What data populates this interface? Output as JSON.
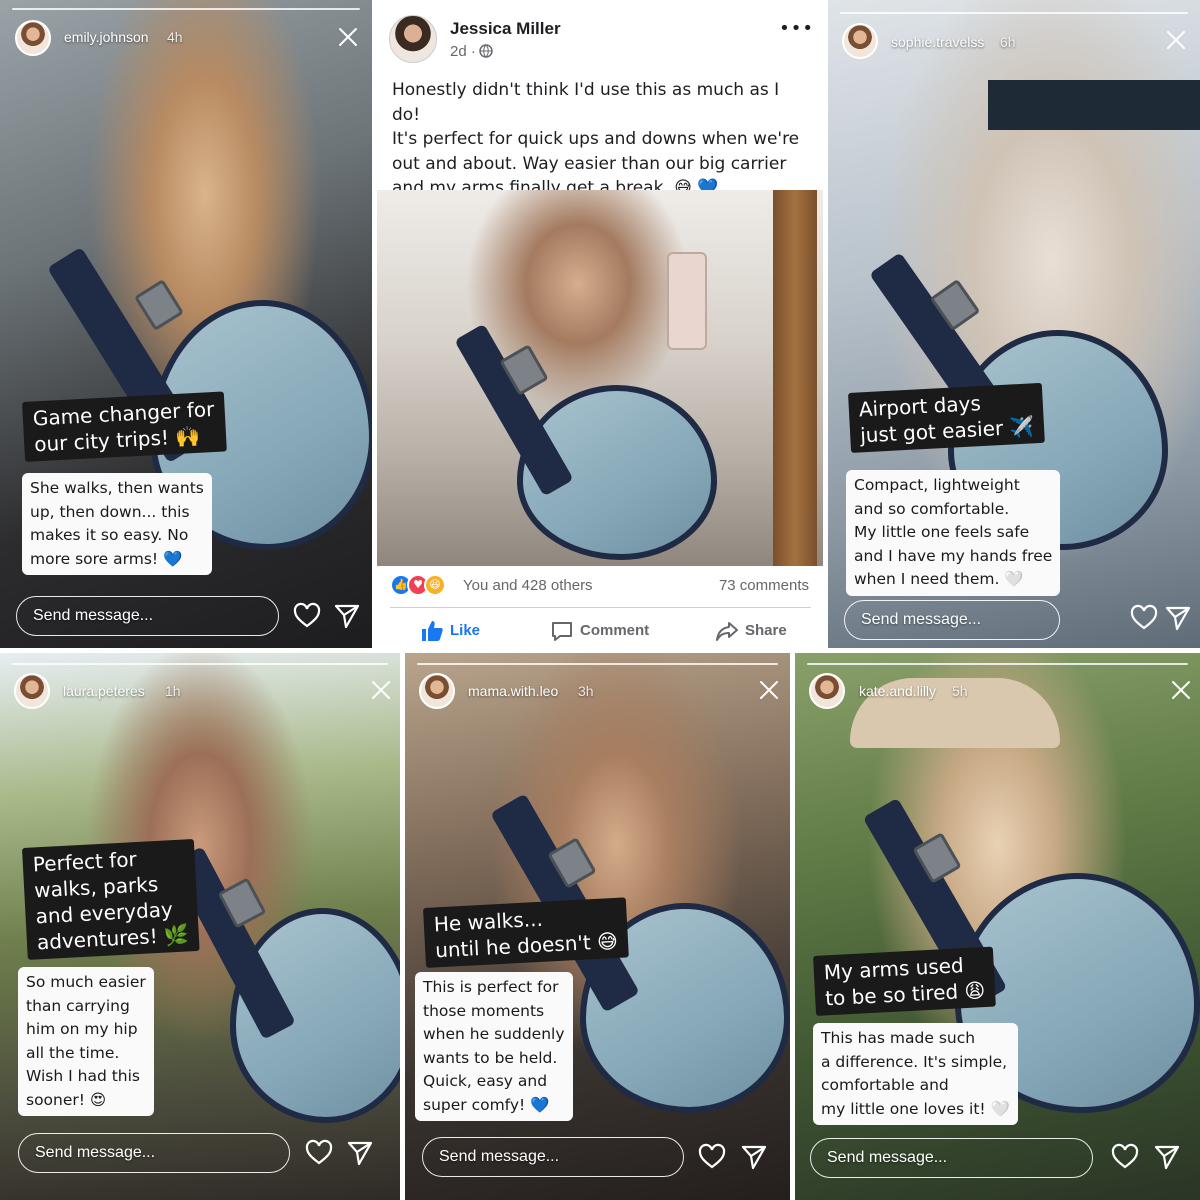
{
  "stories": [
    {
      "username": "emily.johnson",
      "time": "4h",
      "caption": "Game changer for\nour city trips! 🙌",
      "note": "She walks, then wants\nup, then down... this\nmakes it so easy. No\nmore sore arms! 💙",
      "send_placeholder": "Send message..."
    },
    {
      "username": "sophie.travelss",
      "time": "6h",
      "caption": "Airport days\njust got easier ✈️",
      "note": "Compact, lightweight\nand so comfortable.\nMy little one feels safe\nand I have my hands free\nwhen I need them. 🤍",
      "send_placeholder": "Send message..."
    },
    {
      "username": "laura.peteres",
      "time": "1h",
      "caption": "Perfect for\nwalks, parks\nand everyday\nadventures! 🌿",
      "note": "So much easier\nthan carrying\nhim on my hip\nall the time.\nWish I had this\nsooner! 😍",
      "send_placeholder": "Send message..."
    },
    {
      "username": "mama.with.leo",
      "time": "3h",
      "caption": "He walks...\nuntil he doesn't 😅",
      "note": "This is perfect for\nthose moments\nwhen he suddenly\nwants to be held.\nQuick, easy and\nsuper comfy! 💙",
      "send_placeholder": "Send message..."
    },
    {
      "username": "kate.and.lilly",
      "time": "5h",
      "caption": "My arms used\nto be so tired 😩",
      "note": "This has made such\na difference. It's simple,\ncomfortable and\nmy little one loves it! 🤍",
      "send_placeholder": "Send message..."
    }
  ],
  "facebook_post": {
    "author": "Jessica Miller",
    "time": "2d ·",
    "more": "•••",
    "text": "Honestly didn't think I'd use this as much as I do!\nIt's perfect for quick ups and downs when we're\nout and about. Way easier than our big carrier\nand my arms finally get a break. 😅 💙",
    "reactions_text": "You and 428 others",
    "comments_count": "73 comments",
    "actions": {
      "like": "Like",
      "comment": "Comment",
      "share": "Share"
    },
    "colors": {
      "like_blue": "#1877f2",
      "love_red": "#f33e58",
      "haha_yellow": "#f7b125"
    }
  },
  "icons": [
    "heart-icon",
    "send-icon",
    "close-icon",
    "globe-icon",
    "like-icon",
    "comment-icon",
    "share-icon"
  ]
}
